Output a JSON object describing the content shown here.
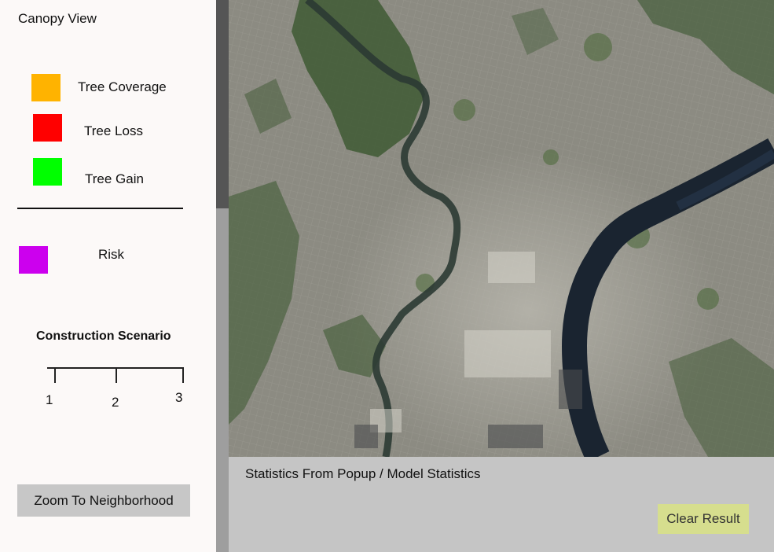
{
  "app": {
    "title": "Canopy View"
  },
  "legend": {
    "items": [
      {
        "label": "Tree Coverage",
        "color": "#ffb300"
      },
      {
        "label": "Tree Loss",
        "color": "#ff0000"
      },
      {
        "label": "Tree Gain",
        "color": "#00ff00"
      }
    ],
    "risk": {
      "label": "Risk",
      "color": "#cc00ee"
    }
  },
  "scenario": {
    "title": "Construction Scenario",
    "ticks": [
      "1",
      "2",
      "3"
    ]
  },
  "sidebar": {
    "zoom_button_label": "Zoom To Neighborhood"
  },
  "map": {
    "type": "satellite-imagery"
  },
  "stats": {
    "title": "Statistics From Popup / Model Statistics",
    "clear_label": "Clear Result"
  },
  "colors": {
    "sidebar_bg": "#fcf9f8",
    "button_gray": "#c7c7c7",
    "clear_button": "#d6de8e",
    "stats_bg": "#c5c5c5",
    "river": "#1a2430"
  }
}
